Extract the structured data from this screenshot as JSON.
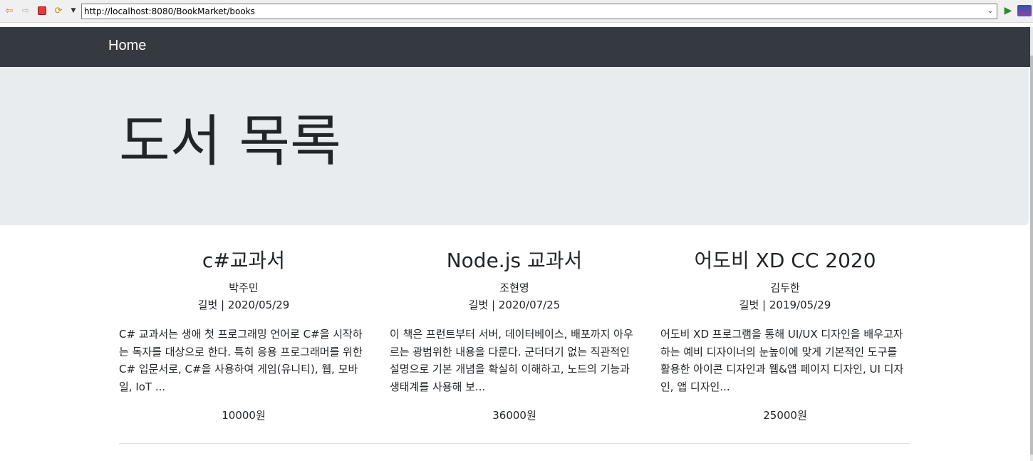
{
  "browser": {
    "url": "http://localhost:8080/BookMarket/books"
  },
  "navbar": {
    "brand": "Home"
  },
  "jumbotron": {
    "title": "도서 목록"
  },
  "books": [
    {
      "title": "c#교과서",
      "author": "박주민",
      "meta": "길벗 | 2020/05/29",
      "description": "C# 교과서는 생애 첫 프로그래밍 언어로 C#을 시작하는 독자를 대상으로 한다. 특히 응용 프로그래머를 위한 C# 입문서로, C#을 사용하여 게임(유니티), 웹, 모바일, IoT ...",
      "price": "10000원"
    },
    {
      "title": "Node.js 교과서",
      "author": "조현영",
      "meta": "길벗 | 2020/07/25",
      "description": "이 책은 프런트부터 서버, 데이터베이스, 배포까지 아우르는 광범위한 내용을 다룬다. 군더더기 없는 직관적인 설명으로 기본 개념을 확실히 이해하고, 노드의 기능과 생태계를 사용해 보...",
      "price": "36000원"
    },
    {
      "title": "어도비 XD CC 2020",
      "author": "김두한",
      "meta": "길벗 | 2019/05/29",
      "description": "어도비 XD 프로그램을 통해 UI/UX 디자인을 배우고자 하는 예비 디자이너의 눈높이에 맞게 기본적인 도구를 활용한 아이콘 디자인과 웹&앱 페이지 디자인, UI 디자인, 앱 디자인...",
      "price": "25000원"
    }
  ]
}
